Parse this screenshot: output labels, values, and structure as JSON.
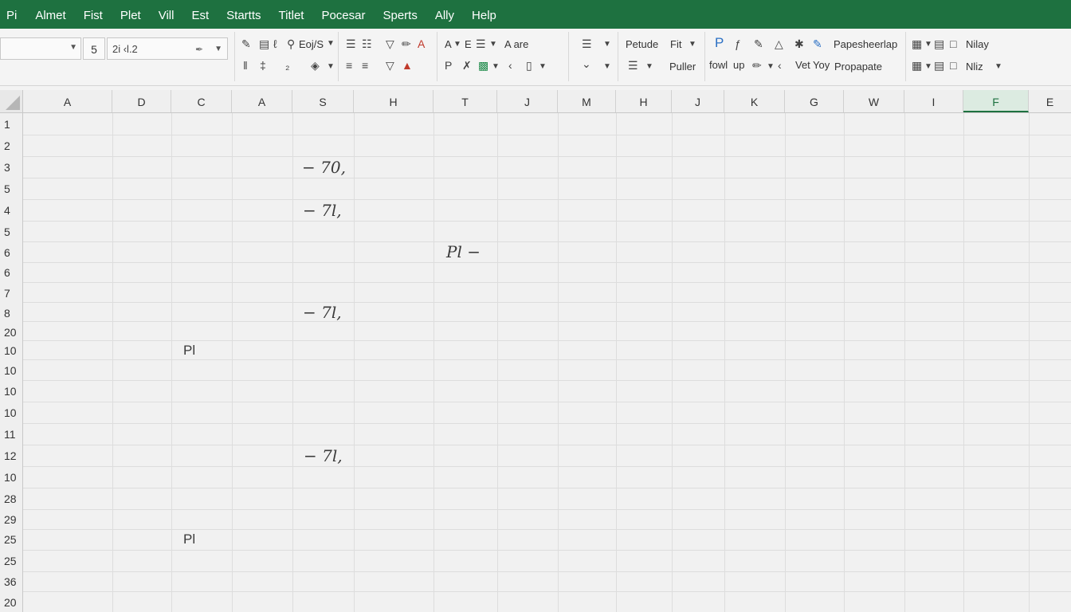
{
  "menu": [
    "Pi",
    "Almet",
    "Fist",
    "Plet",
    "Vill",
    "Est",
    "Startts",
    "Titlet",
    "Pocesar",
    "Sperts",
    "Ally",
    "Help"
  ],
  "ribbon": {
    "font_size": "5",
    "formula": "2i ‹l.2",
    "fmt": "Eoj/S",
    "a_btn": "A",
    "e_btn": "E",
    "a_are": "A are",
    "picture": "Petude",
    "fit": "Fit",
    "puller": "Puller",
    "fowl": "fowl",
    "up": "up",
    "paste_label": "Papesheerlap",
    "vet": "Vet",
    "toy": "Yoy",
    "propagate": "Propapate",
    "nilay": "Nilay",
    "niliz": "Nliz"
  },
  "columns": [
    "A",
    "D",
    "C",
    "A",
    "S",
    "H",
    "T",
    "J",
    "M",
    "H",
    "J",
    "K",
    "G",
    "W",
    "I",
    "F",
    "E"
  ],
  "selected_column": "F",
  "rows": [
    "1",
    "2",
    "3",
    "5",
    "4",
    "5",
    "6",
    "6",
    "7",
    "8",
    "20",
    "10",
    "10",
    "10",
    "10",
    "11",
    "12",
    "10",
    "28",
    "29",
    "25",
    "25",
    "36",
    "20"
  ],
  "cells": {
    "c1": "− 70,",
    "c2": "− 7l,",
    "c3": "Pl −",
    "c4": "− 7l,",
    "c5": "Pl",
    "c6": "− 7l,",
    "c7": "Pl"
  },
  "colors": {
    "menu_bg": "#1e7140",
    "accent": "#1e7140"
  }
}
